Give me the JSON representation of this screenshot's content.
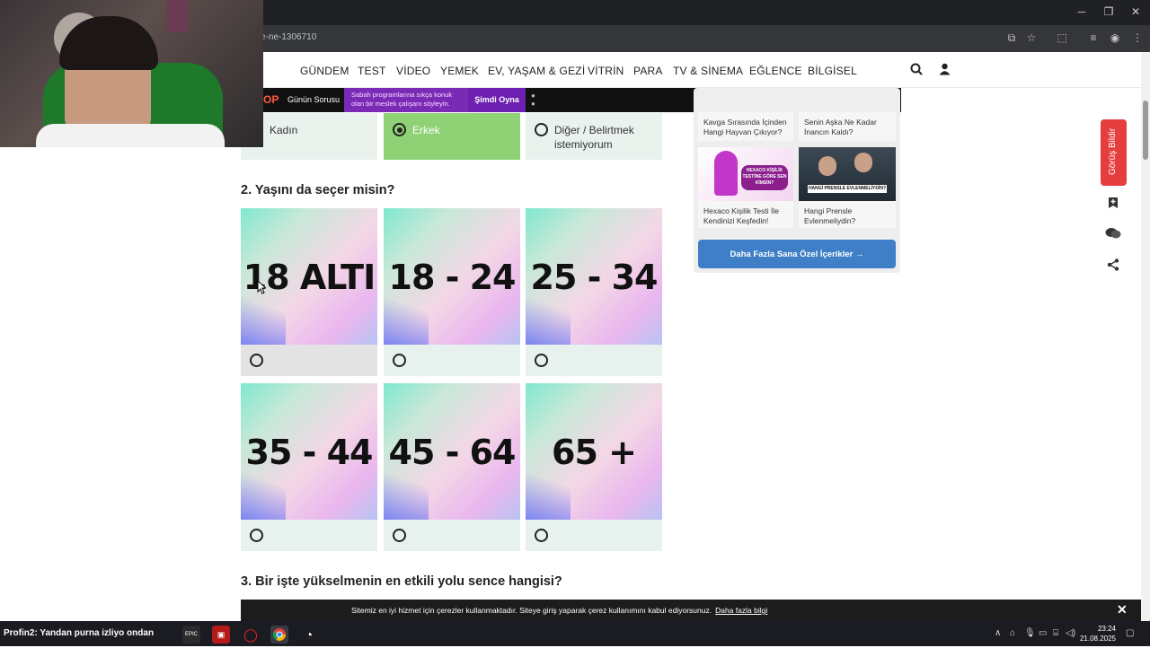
{
  "browser": {
    "url_fragment": "e-ne-1306710",
    "window_controls": [
      "─",
      "❐",
      "✕"
    ]
  },
  "nav": {
    "items": [
      "GÜNDEM",
      "TEST",
      "VİDEO",
      "YEMEK",
      "EV, YAŞAM & GEZİ",
      "VİTRİN",
      "PARA",
      "TV & SİNEMA",
      "EĞLENCE",
      "BİLGİSEL"
    ]
  },
  "promo": {
    "logo": "OP",
    "question_label": "Günün Sorusu",
    "question_text": "Sabah programlarına sıkça konuk olan bir meslek çalışanı söyleyin.",
    "play_label": "Şimdi Oyna"
  },
  "gender_options": [
    {
      "label": "Kadın",
      "selected": false
    },
    {
      "label": "Erkek",
      "selected": true
    },
    {
      "label": "Diğer / Belirtmek istemiyorum",
      "selected": false
    }
  ],
  "question2": {
    "title": "2. Yaşını da seçer misin?",
    "options": [
      "18 ALTI",
      "18 - 24",
      "25 - 34",
      "35 - 44",
      "45 - 64",
      "65 +"
    ]
  },
  "question3": {
    "title": "3. Bir işte yükselmenin en etkili yolu sence hangisi?"
  },
  "sidebar": {
    "top_cards": [
      "Kavga Sırasında İçinden Hangi Hayvan Çıkıyor?",
      "Senin Aşka Ne Kadar İnancın Kaldı?"
    ],
    "bottom_cards": [
      "Hexaco Kişilik Testi İle Kendinizi Keşfedin!",
      "Hangi Prensle Evlenmeliydin?"
    ],
    "thumb1_caption": "HEXACO KİŞİLİK TESTİNE GÖRE SEN KİMSİN?",
    "thumb2_caption": "HANGİ PRENSLE EVLENMELİYDİN?",
    "more_button": "Daha Fazla Sana Özel İçerikler  →"
  },
  "feedback": {
    "label": "Görüş Bildir"
  },
  "cookie": {
    "text": "Sitemiz en iyi hizmet için çerezler kullanmaktadır. Siteye giriş yaparak çerez kullanımını kabul ediyorsunuz.",
    "link": "Daha fazla bilgi",
    "close": "✕"
  },
  "taskbar": {
    "stream_text": "Profin2: Yandan purna izliyo ondan",
    "time": "23:24",
    "date": "21.08.2025"
  },
  "colors": {
    "selected_option": "#8fd175",
    "option_bg": "#eaf2ee",
    "more_button": "#3f7fc7",
    "feedback": "#e63e3e"
  }
}
